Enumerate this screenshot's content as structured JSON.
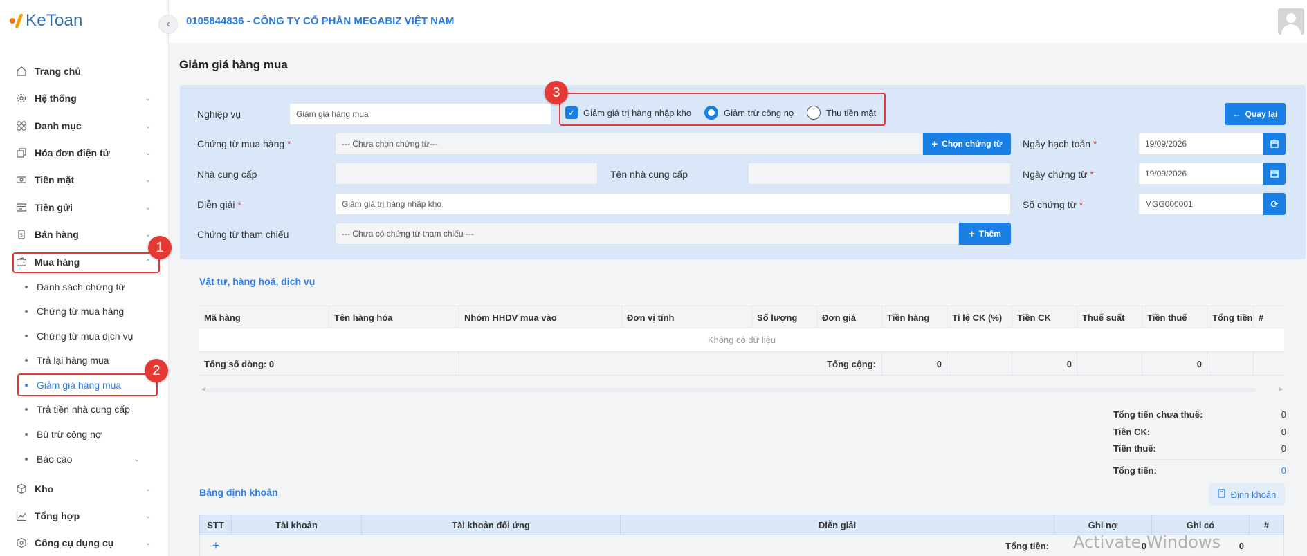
{
  "logo": {
    "text": "KeToan"
  },
  "header": {
    "company": "0105844836 - CÔNG TY CỔ PHẦN MEGABIZ VIỆT NAM"
  },
  "sidebar": {
    "items": [
      {
        "label": "Trang chủ",
        "icon": "home-icon"
      },
      {
        "label": "Hệ thống",
        "icon": "gear-icon"
      },
      {
        "label": "Danh mục",
        "icon": "grid-icon"
      },
      {
        "label": "Hóa đơn điện tử",
        "icon": "invoice-icon"
      },
      {
        "label": "Tiền mặt",
        "icon": "cash-icon"
      },
      {
        "label": "Tiền gửi",
        "icon": "bank-icon"
      },
      {
        "label": "Bán hàng",
        "icon": "sales-icon"
      },
      {
        "label": "Mua hàng",
        "icon": "wallet-icon"
      },
      {
        "label": "Kho",
        "icon": "box-icon"
      },
      {
        "label": "Tổng hợp",
        "icon": "chart-icon"
      },
      {
        "label": "Công cụ dụng cụ",
        "icon": "tools-icon"
      }
    ],
    "purchase_sub": [
      "Danh sách chứng từ",
      "Chứng từ mua hàng",
      "Chứng từ mua dịch vụ",
      "Trả lại hàng mua",
      "Giảm giá hàng mua",
      "Trả tiền nhà cung cấp",
      "Bù trừ công nợ",
      "Báo cáo"
    ],
    "badges": [
      "1",
      "2",
      "3"
    ]
  },
  "page": {
    "title": "Giảm giá hàng mua"
  },
  "form": {
    "nghiep_vu_label": "Nghiệp vụ",
    "nghiep_vu_value": "Giảm giá hàng mua",
    "opt_checkbox": "Giảm giá trị hàng nhập kho",
    "opt_radio1": "Giảm trừ công nợ",
    "opt_radio2": "Thu tiền mặt",
    "back_button": "Quay lại",
    "chung_tu_mua_label": "Chứng từ mua hàng",
    "chung_tu_mua_placeholder": "--- Chưa chọn chứng từ---",
    "chon_chung_tu_button": "Chọn chứng từ",
    "ngay_hach_toan_label": "Ngày hạch toán",
    "ngay_hach_toan_value": "19/09/2026",
    "nha_cung_cap_label": "Nhà cung cấp",
    "ten_nha_cung_cap_label": "Tên nhà cung cấp",
    "ngay_chung_tu_label": "Ngày chứng từ",
    "ngay_chung_tu_value": "19/09/2026",
    "dien_giai_label": "Diễn giải",
    "dien_giai_value": "Giảm giá trị hàng nhập kho",
    "so_chung_tu_label": "Số chứng từ",
    "so_chung_tu_value": "MGG000001",
    "tham_chieu_label": "Chứng từ tham chiếu",
    "tham_chieu_placeholder": "--- Chưa có chứng từ tham chiếu ---",
    "them_button": "Thêm",
    "required_mark": "*"
  },
  "items_section": {
    "title": "Vật tư, hàng hoá, dịch vụ",
    "columns": [
      "Mã hàng",
      "Tên hàng hóa",
      "Nhóm HHDV mua vào",
      "Đơn vị tính",
      "Số lượng",
      "Đơn giá",
      "Tiền hàng",
      "Tỉ lệ CK (%)",
      "Tiền CK",
      "Thuế suất",
      "Tiền thuế",
      "Tổng tiền",
      "#"
    ],
    "empty_text": "Không có dữ liệu",
    "row_count": "Tổng số dòng: 0",
    "total_label": "Tổng cộng:",
    "total_tien_hang": "0",
    "total_tien_ck": "0",
    "total_tien_thue": "0"
  },
  "totals": {
    "chua_thue_label": "Tổng tiền chưa thuế:",
    "chua_thue_value": "0",
    "ck_label": "Tiền CK:",
    "ck_value": "0",
    "thue_label": "Tiền thuế:",
    "thue_value": "0",
    "tong_label": "Tổng tiền:",
    "tong_value": "0"
  },
  "ledger": {
    "title": "Bảng định khoản",
    "button": "Định khoản",
    "columns": [
      "STT",
      "Tài khoản",
      "Tài khoản đối ứng",
      "Diễn giải",
      "Ghi nợ",
      "Ghi có",
      "#"
    ],
    "add_symbol": "+",
    "total_label": "Tổng tiền:",
    "ghi_no_total": "0",
    "ghi_co_total": "0"
  },
  "watermark": "Activate Windows",
  "colors": {
    "primary": "#1a7fe4",
    "highlight": "#e53935",
    "panel": "#d9e7f9"
  }
}
